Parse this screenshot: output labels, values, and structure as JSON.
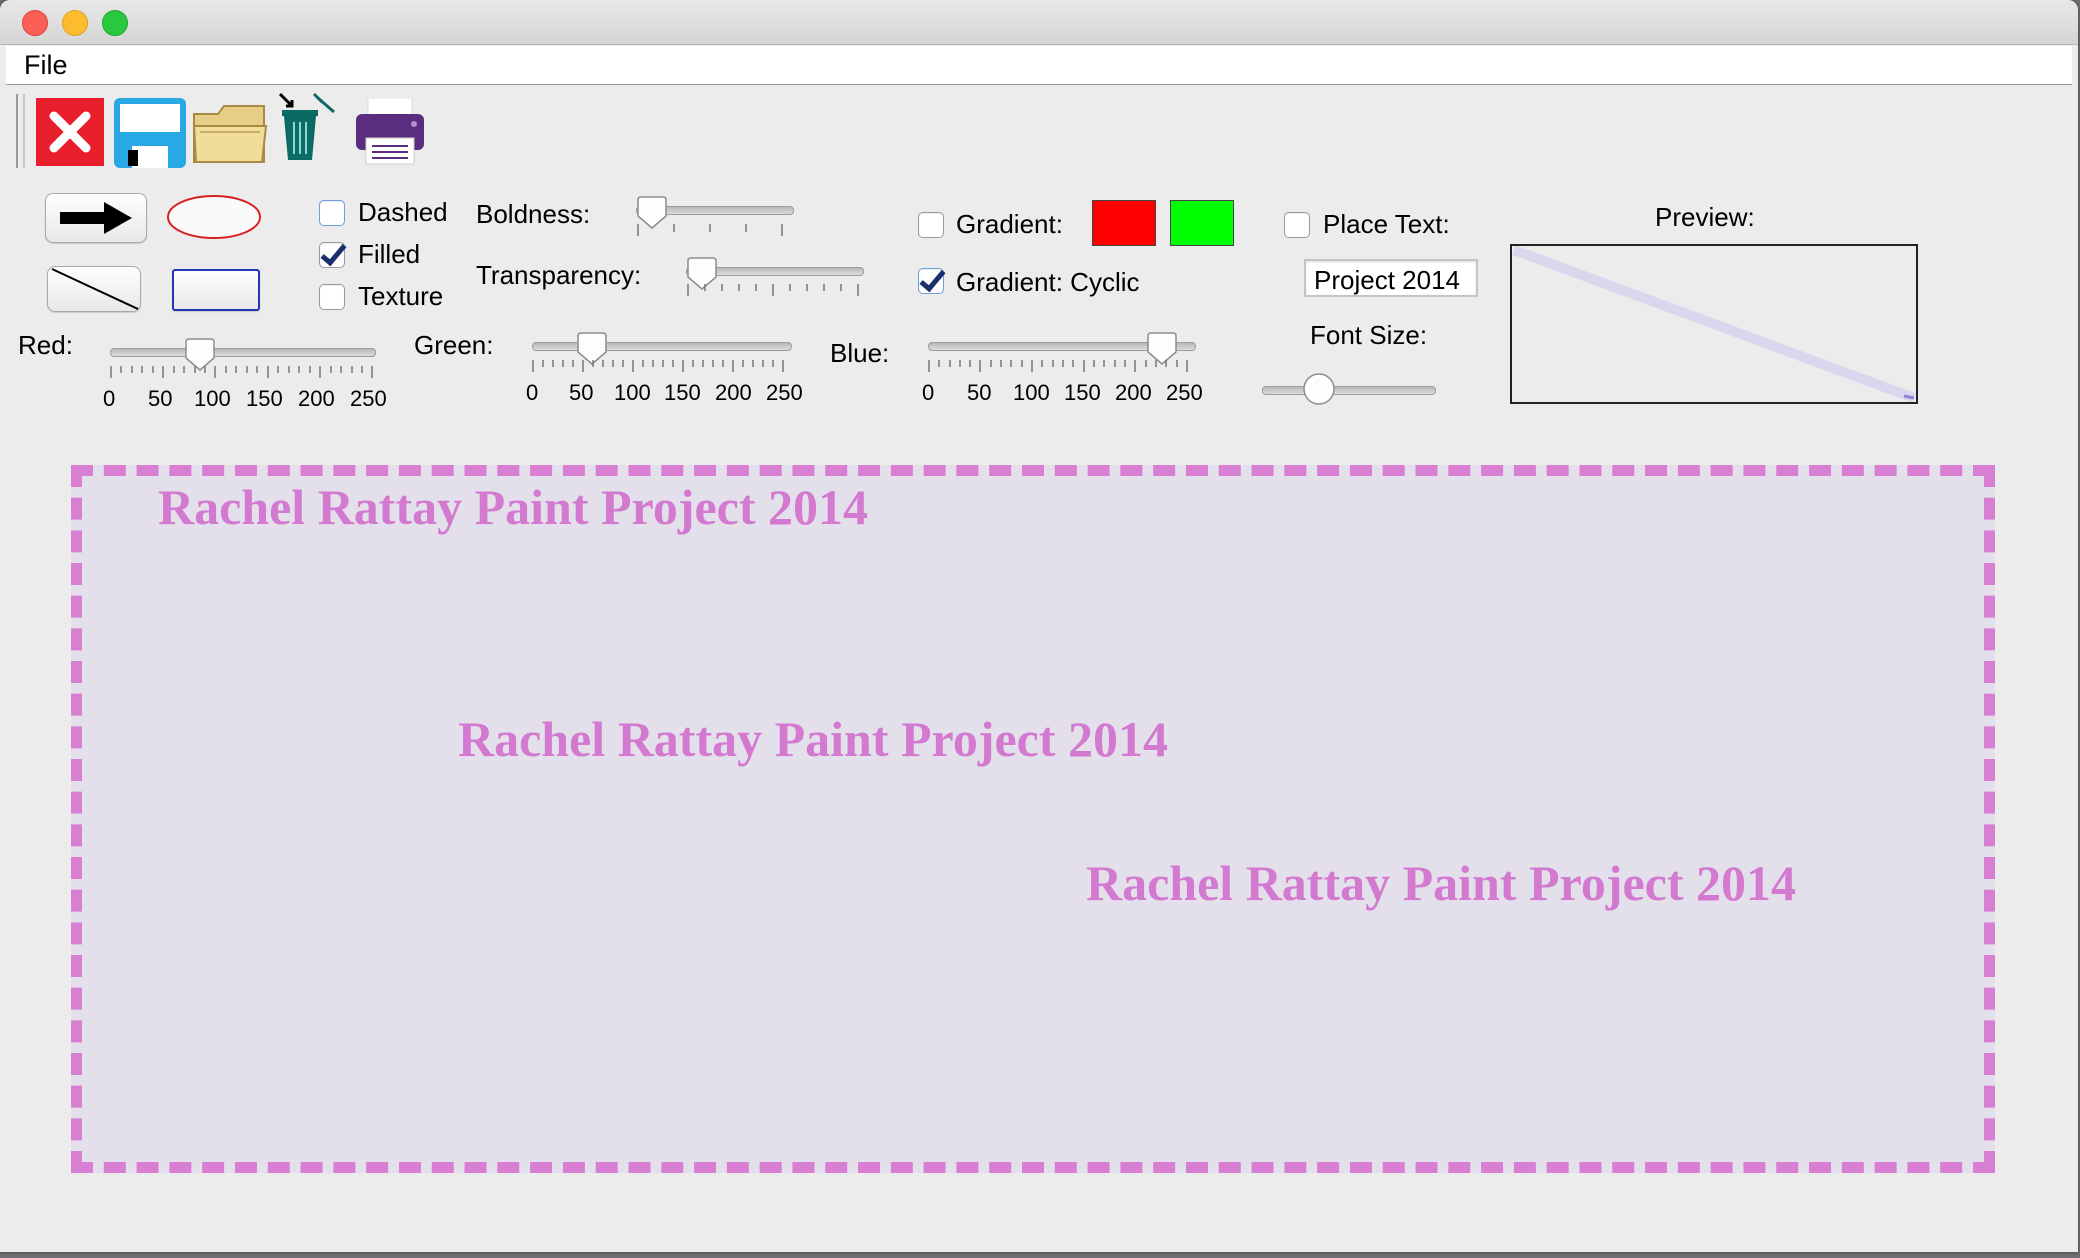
{
  "menu": {
    "file": "File"
  },
  "toolbar": {
    "icons": [
      "close-icon",
      "save-icon",
      "open-folder-icon",
      "clear-trash-icon",
      "print-icon"
    ]
  },
  "options": {
    "dashed": {
      "label": "Dashed",
      "checked": false
    },
    "filled": {
      "label": "Filled",
      "checked": true
    },
    "texture": {
      "label": "Texture",
      "checked": false
    }
  },
  "sliders": {
    "boldness": {
      "label": "Boldness:",
      "value": 2
    },
    "transparency": {
      "label": "Transparency:",
      "value": 5
    },
    "red": {
      "label": "Red:",
      "value": 85,
      "min": 0,
      "max": 255
    },
    "green": {
      "label": "Green:",
      "value": 55,
      "min": 0,
      "max": 255
    },
    "blue": {
      "label": "Blue:",
      "value": 225,
      "min": 0,
      "max": 255
    },
    "font_size": {
      "label": "Font Size:"
    },
    "tick_labels": [
      "0",
      "50",
      "100",
      "150",
      "200",
      "250"
    ]
  },
  "gradient": {
    "label": "Gradient:",
    "checked": false,
    "color1": "#ff0000",
    "color2": "#00ff00",
    "cyclic_label": "Gradient: Cyclic",
    "cyclic_checked": true
  },
  "place_text": {
    "label": "Place Text:",
    "checked": false,
    "value": "Project 2014"
  },
  "preview": {
    "label": "Preview:"
  },
  "canvas": {
    "fill_color": "#e3e0ec",
    "stroke_color": "#d97fd3",
    "texts": [
      "Rachel Rattay Paint Project 2014",
      "Rachel Rattay Paint Project 2014",
      "Rachel Rattay Paint Project 2014"
    ]
  }
}
